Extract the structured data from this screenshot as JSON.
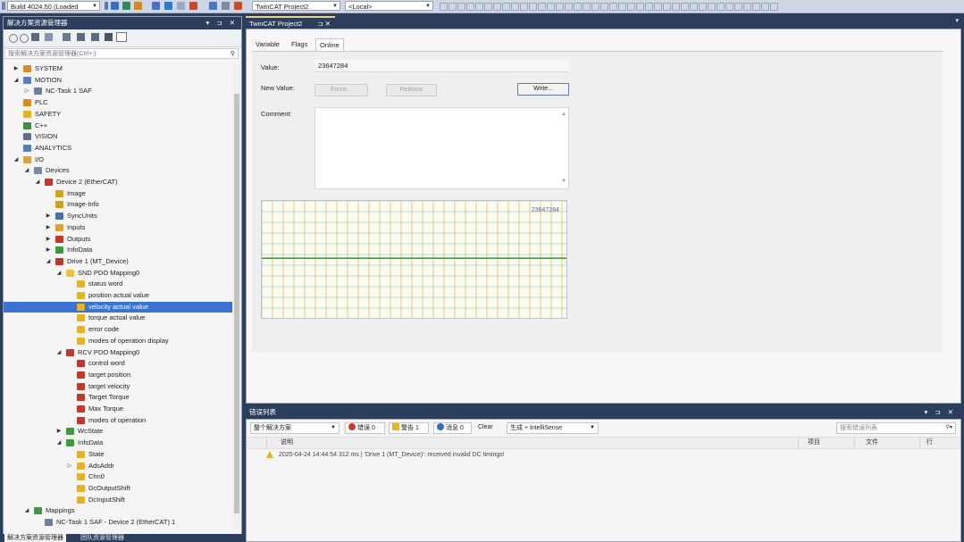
{
  "toolbar": {
    "build_combo": "Build 4024.50 (Loaded",
    "project_combo": "TwinCAT Project2",
    "target_combo": "<Local>"
  },
  "solution_explorer": {
    "title": "解决方案资源管理器",
    "search_placeholder": "搜索解决方案资源管理器(Ctrl+;)",
    "items": [
      {
        "label": "SYSTEM",
        "indent": 0,
        "expander": "▶",
        "icon": "system-icon",
        "color": "#d98b2a"
      },
      {
        "label": "MOTION",
        "indent": 0,
        "expander": "◢",
        "icon": "motion-icon",
        "color": "#5a7fb3"
      },
      {
        "label": "NC-Task 1 SAF",
        "indent": 1,
        "expander": "▷",
        "icon": "nc-task-icon",
        "color": "#6f7f96"
      },
      {
        "label": "PLC",
        "indent": 0,
        "expander": "",
        "icon": "plc-icon",
        "color": "#e08a1e"
      },
      {
        "label": "SAFETY",
        "indent": 0,
        "expander": "",
        "icon": "safety-icon",
        "color": "#e6b422"
      },
      {
        "label": "C++",
        "indent": 0,
        "expander": "",
        "icon": "cpp-icon",
        "color": "#3f8f3f"
      },
      {
        "label": "VISION",
        "indent": 0,
        "expander": "",
        "icon": "vision-icon",
        "color": "#6a6a8a"
      },
      {
        "label": "ANALYTICS",
        "indent": 0,
        "expander": "",
        "icon": "analytics-icon",
        "color": "#4d7fb8"
      },
      {
        "label": "I/O",
        "indent": 0,
        "expander": "◢",
        "icon": "io-icon",
        "color": "#d9a23a"
      },
      {
        "label": "Devices",
        "indent": 1,
        "expander": "◢",
        "icon": "devices-icon",
        "color": "#7a8aa0"
      },
      {
        "label": "Device 2 (EtherCAT)",
        "indent": 2,
        "expander": "◢",
        "icon": "ethercat-icon",
        "color": "#c0392b"
      },
      {
        "label": "Image",
        "indent": 3,
        "expander": "",
        "icon": "image-icon",
        "color": "#d4a017"
      },
      {
        "label": "Image-Info",
        "indent": 3,
        "expander": "",
        "icon": "image-info-icon",
        "color": "#d4a017"
      },
      {
        "label": "SyncUnits",
        "indent": 3,
        "expander": "▶",
        "icon": "syncunits-icon",
        "color": "#4a6fa5"
      },
      {
        "label": "Inputs",
        "indent": 3,
        "expander": "▶",
        "icon": "inputs-icon",
        "color": "#e0a030"
      },
      {
        "label": "Outputs",
        "indent": 3,
        "expander": "▶",
        "icon": "outputs-icon",
        "color": "#c0392b"
      },
      {
        "label": "InfoData",
        "indent": 3,
        "expander": "▶",
        "icon": "infodata-icon",
        "color": "#3f9a3f"
      },
      {
        "label": "Drive 1 (MT_Device)",
        "indent": 3,
        "expander": "◢",
        "icon": "drive-icon",
        "color": "#b03a2e"
      },
      {
        "label": "SND PDO Mapping0",
        "indent": 4,
        "expander": "◢",
        "icon": "folder-icon",
        "color": "#f0c040"
      },
      {
        "label": "status word",
        "indent": 5,
        "expander": "",
        "icon": "var-in-icon",
        "color": "#e6b422"
      },
      {
        "label": "position actual value",
        "indent": 5,
        "expander": "",
        "icon": "var-in-icon",
        "color": "#e6b422"
      },
      {
        "label": "velocity actual value",
        "indent": 5,
        "expander": "",
        "icon": "var-in-icon",
        "color": "#e6b422",
        "selected": true
      },
      {
        "label": "torque actual value",
        "indent": 5,
        "expander": "",
        "icon": "var-in-icon",
        "color": "#e6b422"
      },
      {
        "label": "error code",
        "indent": 5,
        "expander": "",
        "icon": "var-in-icon",
        "color": "#e6b422"
      },
      {
        "label": "modes of operation display",
        "indent": 5,
        "expander": "",
        "icon": "var-in-icon",
        "color": "#e6b422"
      },
      {
        "label": "RCV PDO Mapping0",
        "indent": 4,
        "expander": "◢",
        "icon": "folder-out-icon",
        "color": "#c0392b"
      },
      {
        "label": "control word",
        "indent": 5,
        "expander": "",
        "icon": "var-out-icon",
        "color": "#c0392b"
      },
      {
        "label": "target position",
        "indent": 5,
        "expander": "",
        "icon": "var-out-icon",
        "color": "#c0392b"
      },
      {
        "label": "target velocity",
        "indent": 5,
        "expander": "",
        "icon": "var-out-icon",
        "color": "#c0392b"
      },
      {
        "label": "Target Torque",
        "indent": 5,
        "expander": "",
        "icon": "var-out-icon",
        "color": "#c0392b"
      },
      {
        "label": "Max Torque",
        "indent": 5,
        "expander": "",
        "icon": "var-out-icon",
        "color": "#c0392b"
      },
      {
        "label": "modes of operation",
        "indent": 5,
        "expander": "",
        "icon": "var-out-icon",
        "color": "#c0392b"
      },
      {
        "label": "WcState",
        "indent": 4,
        "expander": "▶",
        "icon": "wcstate-icon",
        "color": "#3f9a3f"
      },
      {
        "label": "InfoData",
        "indent": 4,
        "expander": "◢",
        "icon": "infodata-icon",
        "color": "#3f9a3f"
      },
      {
        "label": "State",
        "indent": 5,
        "expander": "",
        "icon": "var-in-icon",
        "color": "#e6b422"
      },
      {
        "label": "AdsAddr",
        "indent": 5,
        "expander": "▷",
        "icon": "var-in-icon",
        "color": "#e6b422"
      },
      {
        "label": "Chn0",
        "indent": 5,
        "expander": "",
        "icon": "var-in-icon",
        "color": "#e6b422"
      },
      {
        "label": "DcOutputShift",
        "indent": 5,
        "expander": "",
        "icon": "var-in-icon",
        "color": "#e6b422"
      },
      {
        "label": "DcInputShift",
        "indent": 5,
        "expander": "",
        "icon": "var-in-icon",
        "color": "#e6b422"
      },
      {
        "label": "Mappings",
        "indent": 1,
        "expander": "◢",
        "icon": "mappings-icon",
        "color": "#4a8f4a"
      },
      {
        "label": "NC-Task 1 SAF - Device 2 (EtherCAT) 1",
        "indent": 2,
        "expander": "",
        "icon": "mapping-link-icon",
        "color": "#6f7f96"
      }
    ],
    "bottom_tabs": [
      "解决方案资源管理器",
      "团队资源管理器"
    ]
  },
  "document": {
    "tab_title": "TwinCAT Project2",
    "tabs": [
      "Variable",
      "Flags",
      "Online"
    ],
    "active_tab": "Online",
    "value_label": "Value:",
    "value": "23647284",
    "new_value_label": "New Value:",
    "force_label": "Force...",
    "release_label": "Release",
    "write_label": "Write...",
    "comment_label": "Comment:",
    "comment": ""
  },
  "chart_data": {
    "type": "line",
    "title": "",
    "xlabel": "",
    "ylabel": "",
    "annotation": "23647284",
    "series": [
      {
        "values": [
          23647284,
          23647284,
          23647284,
          23647284,
          23647284,
          23647284,
          23647284,
          23647284,
          23647284,
          23647284,
          23647284
        ]
      }
    ],
    "line_color": "#3aa040",
    "grid": true,
    "grid_color": "#e8ba6a",
    "grid_h_color": "#9fd0d8",
    "background": "#fbfced"
  },
  "error_list": {
    "title": "错误列表",
    "scope": "整个解决方案",
    "errors_label": "错误 0",
    "warnings_label": "警告 1",
    "messages_label": "消息 0",
    "clear_label": "Clear",
    "build_filter": "生成 + IntelliSense",
    "search_placeholder": "搜索错误列表",
    "columns": [
      "说明",
      "项目",
      "文件",
      "行"
    ],
    "rows": [
      {
        "severity": "warning",
        "description": "2025-04-24 14:44:54 312 ms | 'Drive 1 (MT_Device)': received invalid DC timings!"
      }
    ]
  }
}
